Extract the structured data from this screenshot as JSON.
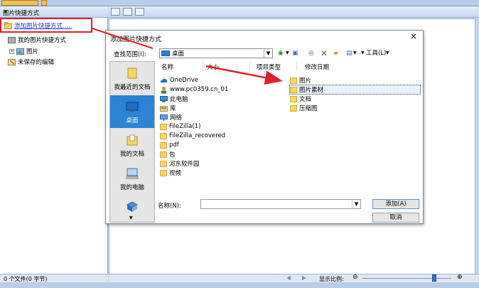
{
  "left_panel": {
    "title": "图片快捷方式",
    "close": "×",
    "add_link": "添加图片快捷方式.....",
    "tree": [
      {
        "label": "我的图片快捷方式",
        "icon": "shortcut-folder-icon"
      },
      {
        "label": "图片",
        "icon": "picture-folder-icon"
      },
      {
        "label": "未保存的编辑",
        "icon": "unsaved-edits-icon"
      }
    ],
    "status": "0 个文件(0 字节)"
  },
  "status_right": {
    "scale_label": "显示比例:"
  },
  "dialog": {
    "title": "添加图片快捷方式",
    "close": "×",
    "lookin_label": "查找范围(I):",
    "lookin_value": "桌面",
    "tools_label": "工具(L)",
    "places": [
      {
        "label": "我最近的文档",
        "icon": "recent-docs-icon"
      },
      {
        "label": "桌面",
        "icon": "desktop-icon"
      },
      {
        "label": "我的文档",
        "icon": "my-documents-icon"
      },
      {
        "label": "我的电脑",
        "icon": "my-computer-icon"
      },
      {
        "label": "",
        "icon": "network-places-icon"
      }
    ],
    "columns": [
      "名称",
      "大小",
      "项目类型",
      "修改日期"
    ],
    "left_items": [
      {
        "label": "OneDrive",
        "icon": "onedrive-icon"
      },
      {
        "label": "www.pc0359.cn_01",
        "icon": "user-icon"
      },
      {
        "label": "此电脑",
        "icon": "computer-icon"
      },
      {
        "label": "库",
        "icon": "library-icon"
      },
      {
        "label": "网络",
        "icon": "network-icon"
      },
      {
        "label": "FileZilla(1)",
        "icon": "folder-icon"
      },
      {
        "label": "FileZilla_recovered",
        "icon": "folder-icon"
      },
      {
        "label": "pdf",
        "icon": "folder-icon"
      },
      {
        "label": "包",
        "icon": "folder-icon"
      },
      {
        "label": "河东软件园",
        "icon": "folder-icon"
      },
      {
        "label": "视频",
        "icon": "folder-icon"
      }
    ],
    "right_items": [
      {
        "label": "图片",
        "icon": "folder-icon"
      },
      {
        "label": "图片素材",
        "icon": "folder-icon"
      },
      {
        "label": "文档",
        "icon": "folder-icon"
      },
      {
        "label": "压缩图",
        "icon": "folder-icon"
      }
    ],
    "name_label": "名称(N):",
    "name_value": "",
    "add_button": "添加(A)",
    "cancel_button": "取消"
  },
  "colors": {
    "accent_red": "#e0202a",
    "selection_blue": "#2b83d6",
    "link_blue": "#1a3fd0"
  }
}
